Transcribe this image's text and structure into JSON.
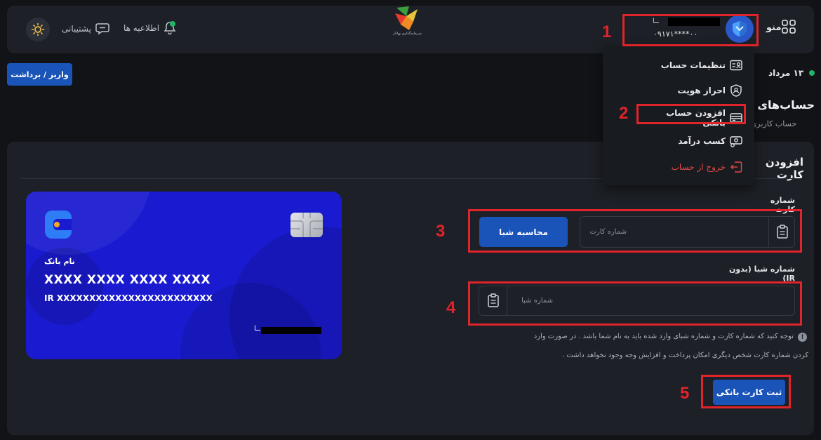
{
  "header": {
    "support_label": "پشتیبانی",
    "notifications_label": "اطلاعیه ها",
    "user_name_tail": "ــا",
    "user_phone": "۰۹۱۷۱****۰۰",
    "menu_label": "منو",
    "logo_caption": "سرمایه‌گذاری بهادار"
  },
  "toolbar": {
    "deposit_withdraw_label": "واریز / برداشت"
  },
  "status": {
    "date": "۱۳ مرداد"
  },
  "page": {
    "title": "حساب‌های بانکی",
    "breadcrumb_root": "حساب کاربری",
    "breadcrumb_sep": "/"
  },
  "dropdown": {
    "items": [
      {
        "label": "تنظیمات حساب",
        "icon": "id-card-icon"
      },
      {
        "label": "احراز هویت",
        "icon": "shield-check-icon"
      },
      {
        "label": "افزودن حساب بانکی",
        "icon": "credit-card-icon"
      },
      {
        "label": "کسب درآمد",
        "icon": "money-icon"
      },
      {
        "label": "خروج از حساب",
        "icon": "logout-icon"
      }
    ]
  },
  "form": {
    "title": "افزودن کارت",
    "card_number_label": "شماره کارت",
    "card_number_placeholder": "شماره کارت",
    "calc_sheba_label": "محاسبه شبا",
    "sheba_label": "شماره شبا (بدون IR)",
    "sheba_placeholder": "شماره شبا",
    "notice_line1": "توجه کنید که شماره کارت و شماره شبای وارد شده باید به نام شما باشد . در صورت وارد",
    "notice_line2": "کردن شماره کارت شخص دیگری امکان پرداخت و افزایش وجه وجود نخواهد داشت .",
    "submit_label": "ثبت کارت بانکی"
  },
  "card_preview": {
    "bank_name": "نام بانک",
    "number": "XXXX XXXX XXXX XXXX",
    "iban": "IR XXXXXXXXXXXXXXXXXXXXXXXX",
    "holder_tail": "ــا"
  },
  "annotations": [
    "1",
    "2",
    "3",
    "4",
    "5"
  ],
  "colors": {
    "accent": "#1b54b8",
    "annotation": "#e0242b",
    "card_bg": "#1a1bd0",
    "online": "#1fb36b",
    "logout": "#e24a4a"
  }
}
